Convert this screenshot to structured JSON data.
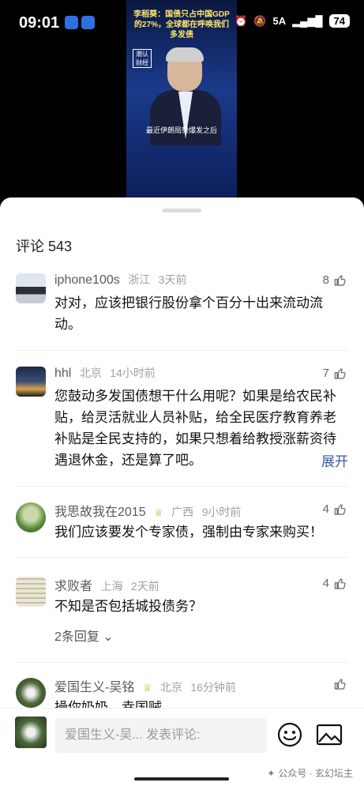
{
  "status_bar": {
    "time": "09:01",
    "network": "5A",
    "battery": "74"
  },
  "video": {
    "headline": "李稻葵：国债只占中国GDP的27%，全球都在呼唤我们多发债",
    "logo_text": "潮认财经",
    "subtitle": "最近伊朗局势爆发之后"
  },
  "comments_header": {
    "label": "评论 543"
  },
  "comments": [
    {
      "user": "iphone100s",
      "location": "浙江",
      "time_ago": "3天前",
      "likes": "8",
      "text": "对对，应该把银行股份拿个百分十出来流动流动。"
    },
    {
      "user": "hhl",
      "location": "北京",
      "time_ago": "14小时前",
      "likes": "7",
      "text": "您鼓动多发国债想干什么用呢？如果是给农民补贴，给灵活就业人员补贴，给全民医疗教育养老补贴是全民支持的，如果只想着给教授涨薪资待遇退休金，还是算了吧。",
      "expand_label": "展开"
    },
    {
      "user": "我思故我在2015",
      "location": "广西",
      "time_ago": "9小时前",
      "likes": "4",
      "text": "我们应该要发个专家债，强制由专家来购买！"
    },
    {
      "user": "求败者",
      "location": "上海",
      "time_ago": "2天前",
      "likes": "4",
      "text": "不知是否包括城投债务？",
      "replies_label": "2条回复"
    },
    {
      "user": "爱国生义-吴铭",
      "location": "北京",
      "time_ago": "16分钟前",
      "likes": "",
      "text": "操你奶奶，幸国贼"
    }
  ],
  "composer": {
    "placeholder": "爱国生义-吴... 发表评论:"
  },
  "watermark": "公众号 · 玄幻坛主"
}
